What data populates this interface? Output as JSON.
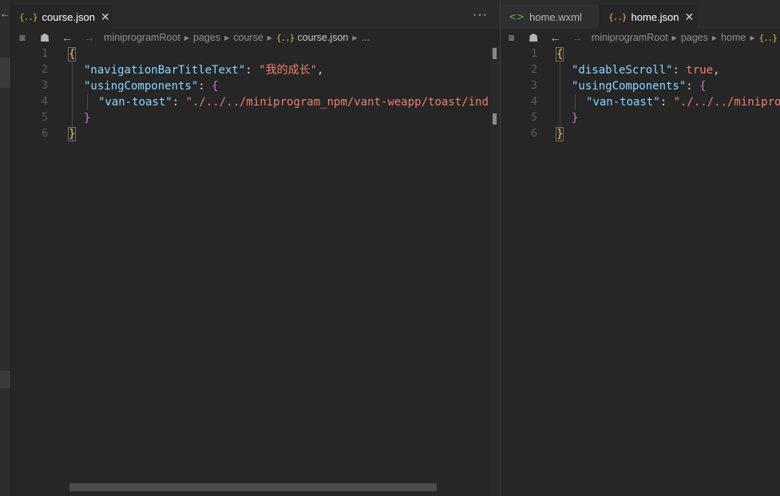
{
  "sidebar": {
    "back_icon": "arrow-left-icon"
  },
  "left_pane": {
    "tabs": [
      {
        "label": "course.json",
        "icon": "{..}",
        "active": true
      }
    ],
    "more_label": "···",
    "breadcrumb": [
      "miniprogramRoot",
      "pages",
      "course",
      "course.json",
      "..."
    ],
    "line_numbers": [
      "1",
      "2",
      "3",
      "4",
      "5",
      "6"
    ],
    "code": {
      "l1_open": "{",
      "l2_key": "\"navigationBarTitleText\"",
      "l2_colon": ": ",
      "l2_val": "\"我的成长\"",
      "l2_comma": ",",
      "l3_key": "\"usingComponents\"",
      "l3_colon": ": ",
      "l3_open": "{",
      "l4_key": "\"van-toast\"",
      "l4_colon": ": ",
      "l4_val": "\"./../../miniprogram_npm/vant-weapp/toast/index\"",
      "l5_close": "}",
      "l6_close": "}"
    }
  },
  "right_pane": {
    "tabs": [
      {
        "label": "home.wxml",
        "icon": "<>",
        "active": false
      },
      {
        "label": "home.json",
        "icon": "{..}",
        "active": true
      }
    ],
    "breadcrumb": [
      "miniprogramRoot",
      "pages",
      "home",
      "{..}"
    ],
    "line_numbers": [
      "1",
      "2",
      "3",
      "4",
      "5",
      "6"
    ],
    "code": {
      "l1_open": "{",
      "l2_key": "\"disableScroll\"",
      "l2_colon": ": ",
      "l2_val": "true",
      "l2_comma": ",",
      "l3_key": "\"usingComponents\"",
      "l3_colon": ": ",
      "l3_open": "{",
      "l4_key": "\"van-toast\"",
      "l4_colon": ": ",
      "l4_val": "\"./../../miniprogram_npm/vant-weapp/toast/index\"",
      "l5_close": "}",
      "l6_close": "}"
    }
  },
  "colors": {
    "background": "#262626",
    "key": "#8fd3ff",
    "string": "#ef7f6e",
    "bracket_outer": "#f2c94c",
    "bracket_inner": "#d36ddb"
  }
}
